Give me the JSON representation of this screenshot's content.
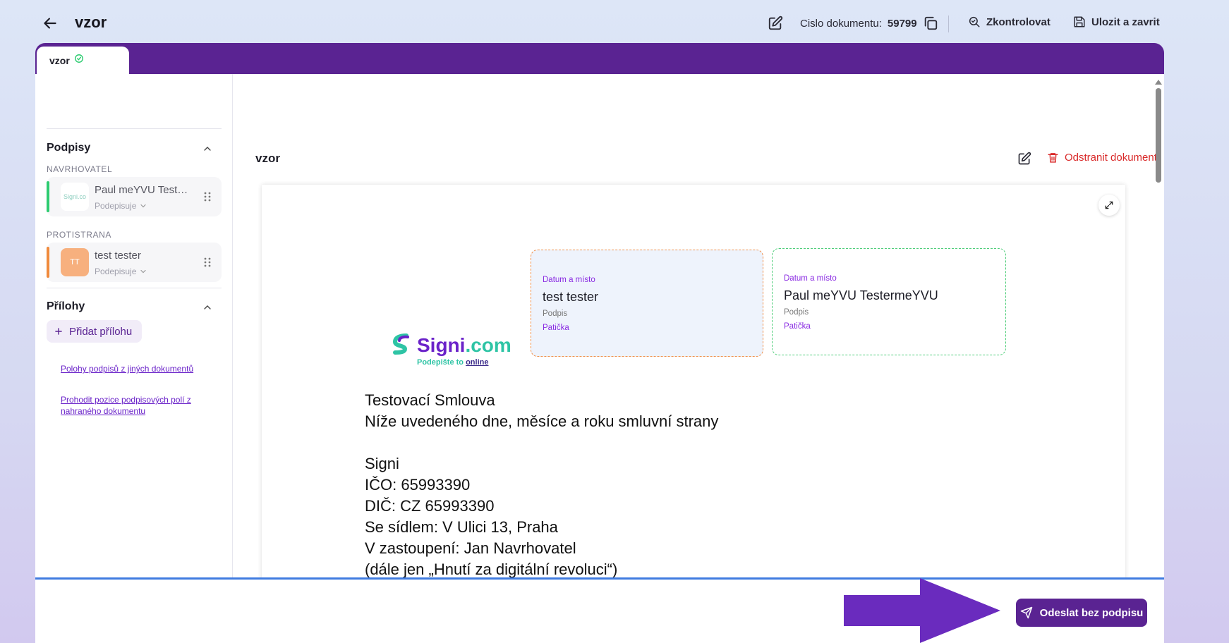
{
  "header": {
    "title": "vzor",
    "doc_number_label": "Cislo dokumentu:",
    "doc_number_value": "59799",
    "check_label": "Zkontrolovat",
    "save_close_label": "Ulozit a zavrit"
  },
  "tab": {
    "label": "vzor"
  },
  "sidebar": {
    "signatures_title": "Podpisy",
    "proposer_label": "NAVRHOVATEL",
    "proposer": {
      "avatar_text": "Signi.co",
      "name": "Paul meYVU Tester...",
      "role": "Podepisuje",
      "color": "#2ecc71"
    },
    "counterparty_label": "PROTISTRANA",
    "counterparty": {
      "avatar_text": "TT",
      "name": "test tester",
      "role": "Podepisuje",
      "color": "#f08a3c"
    },
    "attachments_title": "Přílohy",
    "add_attachment_label": "Přidat přílohu",
    "link1": "Polohy podpisů z jiných dokumentů",
    "link2_line1": "Prohodit pozice podpisových polí z",
    "link2_line2": "nahraného dokumentu"
  },
  "content": {
    "doc_name": "vzor",
    "remove_label": "Odstranit dokument",
    "logo_main": "Signi",
    "logo_suffix": ".com",
    "logo_tag": "Podepište to",
    "logo_tag_bold": "online",
    "sig_box_1": {
      "label": "Datum a místo",
      "name": "test tester",
      "sign": "Podpis",
      "footer": "Patička"
    },
    "sig_box_2": {
      "label": "Datum a místo",
      "name": "Paul meYVU TestermeYVU",
      "sign": "Podpis",
      "footer": "Patička"
    },
    "doc_lines": [
      "Testovací Smlouva",
      "Níže uvedeného dne, měsíce a roku smluvní strany",
      "Signi",
      "IČO: 65993390",
      "DIČ: CZ 65993390",
      "Se sídlem: V Ulici 13, Praha",
      "V zastoupení: Jan Navrhovatel",
      "(dále jen „Hnutí za digitální revoluci“)"
    ]
  },
  "footer": {
    "send_label": "Odeslat bez podpisu"
  },
  "colors": {
    "brand_purple": "#5a2392",
    "danger": "#d92a2a",
    "accent_blue": "#3f7be0"
  }
}
